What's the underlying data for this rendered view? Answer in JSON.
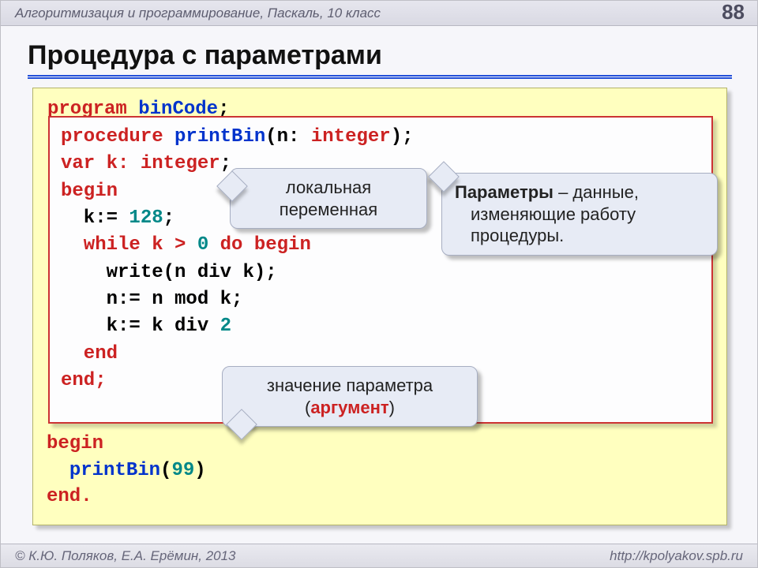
{
  "header": {
    "crumb": "Алгоритмизация и программирование, Паскаль, 10 класс",
    "page": "88"
  },
  "title": "Процедура с параметрами",
  "outer": {
    "program": "program",
    "progName": "binCode",
    "semi": ";",
    "begin": "begin",
    "call_indent": "  ",
    "callName": "printBin",
    "lp": "(",
    "arg": "99",
    "rp": ")",
    "end": "end."
  },
  "inner": {
    "l1_a": "procedure ",
    "l1_b": "printBin",
    "l1_c": "(n: ",
    "l1_d": "integer",
    "l1_e": ");",
    "l2_a": "var k: ",
    "l2_b": "integer",
    "l2_c": ";",
    "l3": "begin",
    "l4_a": "  k:= ",
    "l4_b": "128",
    "l4_c": ";",
    "l5_a": "  while k > ",
    "l5_b": "0",
    "l5_c": " do begin",
    "l6": "    write(n div k);",
    "l7": "    n:= n mod k;",
    "l8_a": "    k:= k div ",
    "l8_b": "2",
    "l9": "  end",
    "l10": "end;"
  },
  "callouts": {
    "local_l1": "локальная",
    "local_l2": "переменная",
    "params_bold": "Параметры",
    "params_rest1": " – данные,",
    "params_rest2": "изменяющие работу",
    "params_rest3": "процедуры.",
    "arg_l1": "значение параметра",
    "arg_lp": "(",
    "arg_word": "аргумент",
    "arg_rp": ")"
  },
  "footer": {
    "left": "© К.Ю. Поляков, Е.А. Ерёмин, 2013",
    "right": "http://kpolyakov.spb.ru"
  }
}
